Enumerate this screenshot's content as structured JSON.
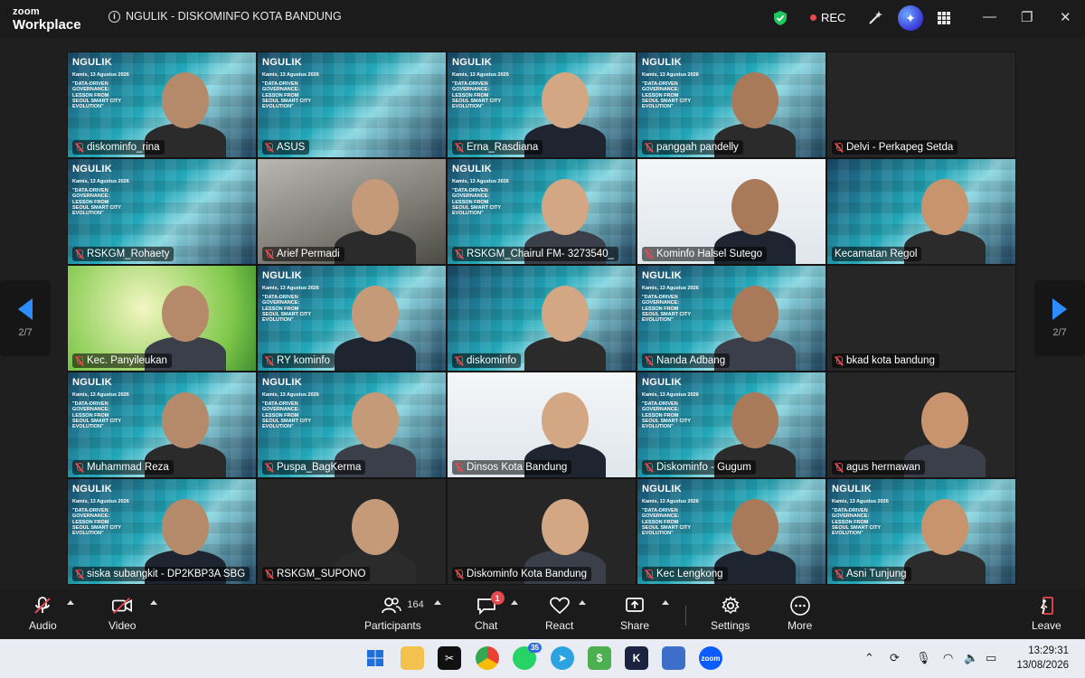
{
  "app": {
    "logo_line1": "zoom",
    "logo_line2": "Workplace",
    "meeting_title": "NGULIK - DISKOMINFO KOTA BANDUNG",
    "rec_label": "REC"
  },
  "slide": {
    "brand": "NGULIK",
    "date": "Kamis, 13 Agustus 2026",
    "lines": "\"DATA-DRIVEN GOVERNANCE: LESSON FROM SEOUL SMART CITY EVOLUTION\""
  },
  "participants": [
    {
      "name": "diskominfo_rina",
      "muted": true
    },
    {
      "name": "ASUS",
      "muted": true
    },
    {
      "name": "Erna_Rasdiana",
      "muted": true
    },
    {
      "name": "panggah pandelly",
      "muted": true
    },
    {
      "name": "Delvi - Perkapeg Setda",
      "muted": true
    },
    {
      "name": "RSKGM_Rohaety",
      "muted": true
    },
    {
      "name": "Arief Permadi",
      "muted": true
    },
    {
      "name": "RSKGM_Chairul FM- 3273540_",
      "muted": true
    },
    {
      "name": "Kominfo Halsel Sutego",
      "muted": true
    },
    {
      "name": "Kecamatan Regol",
      "muted": false
    },
    {
      "name": "Kec. Panyileukan",
      "muted": true
    },
    {
      "name": "RY kominfo",
      "muted": true
    },
    {
      "name": "diskominfo",
      "muted": true
    },
    {
      "name": "Nanda Adbang",
      "muted": true
    },
    {
      "name": "bkad kota bandung",
      "muted": true
    },
    {
      "name": "Muhammad Reza",
      "muted": true
    },
    {
      "name": "Puspa_BagKerma",
      "muted": true
    },
    {
      "name": "Dinsos Kota Bandung",
      "muted": true
    },
    {
      "name": "Diskominfo - Gugum",
      "muted": true
    },
    {
      "name": "agus hermawan",
      "muted": true
    },
    {
      "name": "siska subangkit - DP2KBP3A SBG",
      "muted": true
    },
    {
      "name": "RSKGM_SUPONO",
      "muted": true
    },
    {
      "name": "Diskominfo Kota Bandung",
      "muted": true
    },
    {
      "name": "Kec Lengkong",
      "muted": true
    },
    {
      "name": "Asni Tunjung",
      "muted": true
    }
  ],
  "pagination": {
    "left": "2/7",
    "right": "2/7"
  },
  "toolbar": {
    "audio": "Audio",
    "video": "Video",
    "participants": "Participants",
    "participants_count": "164",
    "chat": "Chat",
    "chat_badge": "1",
    "react": "React",
    "share": "Share",
    "settings": "Settings",
    "more": "More",
    "leave": "Leave"
  },
  "taskbar": {
    "whatsapp_badge": "35",
    "time": "13:29:31",
    "date": "13/08/2026"
  }
}
